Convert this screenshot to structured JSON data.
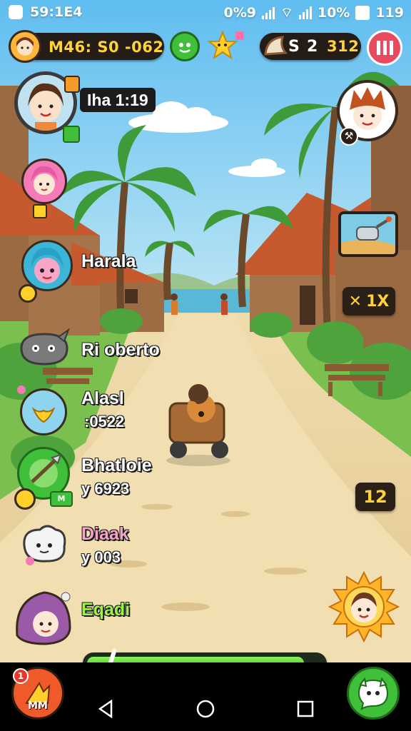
{
  "status_bar": {
    "time": "59:1E4",
    "right_text_1": "0%9",
    "right_text_2": "10%",
    "right_text_3": "119"
  },
  "hud": {
    "coins": "M46: S0 -062",
    "resource_a": "S",
    "resource_b": "2",
    "resource_c": "312",
    "pause_icon": "pause-icon"
  },
  "player": {
    "name": "Iha 1:19"
  },
  "roster": [
    {
      "name": "Harala",
      "sub": ""
    },
    {
      "name": "Ri oberto",
      "sub": ""
    },
    {
      "name": "Alasl",
      "sub": ":0522"
    },
    {
      "name": "Bhatloie",
      "sub": "y   6923"
    },
    {
      "name": "Diaak",
      "sub": "y  003"
    },
    {
      "name": "Eqadi",
      "sub": ""
    }
  ],
  "side_items": {
    "tool_count": "1X",
    "level": "12"
  },
  "bottom": {
    "left_button_label": "MM",
    "left_button_badge": "1",
    "progress_pct": 92
  },
  "colors": {
    "sky": "#6cc6f0",
    "sand": "#e9d3a0",
    "grass": "#5fa83a",
    "pause_red": "#e84a5f",
    "progress_green": "#5fd634",
    "name_pink": "#f5a3c6",
    "name_green": "#9ff24a"
  }
}
